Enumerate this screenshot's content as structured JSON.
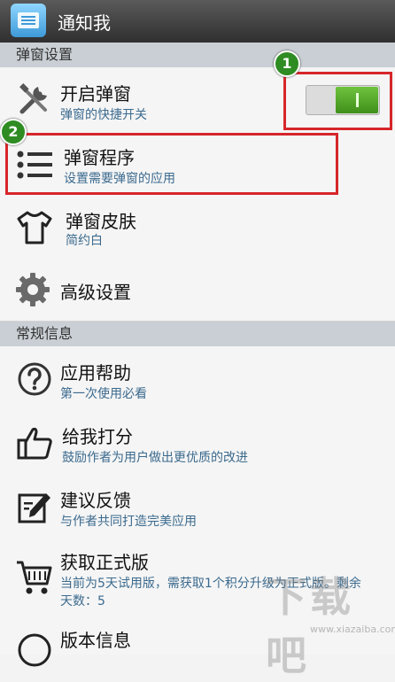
{
  "header": {
    "title": "通知我",
    "icon": "notification-list-icon"
  },
  "sections": {
    "popup": "弹窗设置",
    "general": "常规信息"
  },
  "rows": {
    "enable": {
      "title": "开启弹窗",
      "sub": "弹窗的快捷开关",
      "icon": "tools-icon",
      "toggle_on": true
    },
    "apps": {
      "title": "弹窗程序",
      "sub": "设置需要弹窗的应用",
      "icon": "list-icon"
    },
    "skin": {
      "title": "弹窗皮肤",
      "sub": "简约白",
      "icon": "tshirt-icon"
    },
    "advanced": {
      "title": "高级设置",
      "icon": "gear-icon"
    },
    "help": {
      "title": "应用帮助",
      "sub": "第一次使用必看",
      "icon": "help-icon"
    },
    "rate": {
      "title": "给我打分",
      "sub": "鼓励作者为用户做出更优质的改进",
      "icon": "thumbs-up-icon"
    },
    "feedback": {
      "title": "建议反馈",
      "sub": "与作者共同打造完美应用",
      "icon": "edit-icon"
    },
    "purchase": {
      "title": "获取正式版",
      "sub": "当前为5天试用版，需获取1个积分升级为正式版。剩余天数：5",
      "icon": "cart-icon"
    },
    "version": {
      "title": "版本信息",
      "icon": "info-icon"
    }
  },
  "annotations": {
    "badge1": "1",
    "badge2": "2"
  },
  "watermark": {
    "text": "下载吧",
    "url": "www.xiazaiba.com"
  },
  "colors": {
    "accent_green": "#3f8f1a",
    "highlight_red": "#d6262a",
    "subtitle_blue": "#3b6a8e"
  }
}
